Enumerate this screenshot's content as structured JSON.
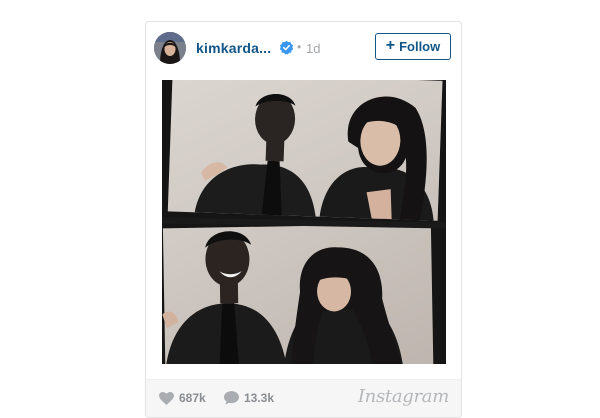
{
  "post": {
    "username": "kimkarda...",
    "verified_icon": "verified-badge-icon",
    "separator": "•",
    "time_ago": "1d",
    "follow_label": "Follow",
    "follow_icon": "plus-icon",
    "photo_icon": "photo-booth-image",
    "likes_icon": "heart-icon",
    "likes_count": "687k",
    "comments_icon": "comment-icon",
    "comments_count": "13.3k",
    "brand": "Instagram"
  },
  "colors": {
    "username": "#125688",
    "muted": "#a5a7aa",
    "verified": "#3897f0",
    "footer_bg": "#f6f6f6",
    "photo_bg": "#151515"
  }
}
